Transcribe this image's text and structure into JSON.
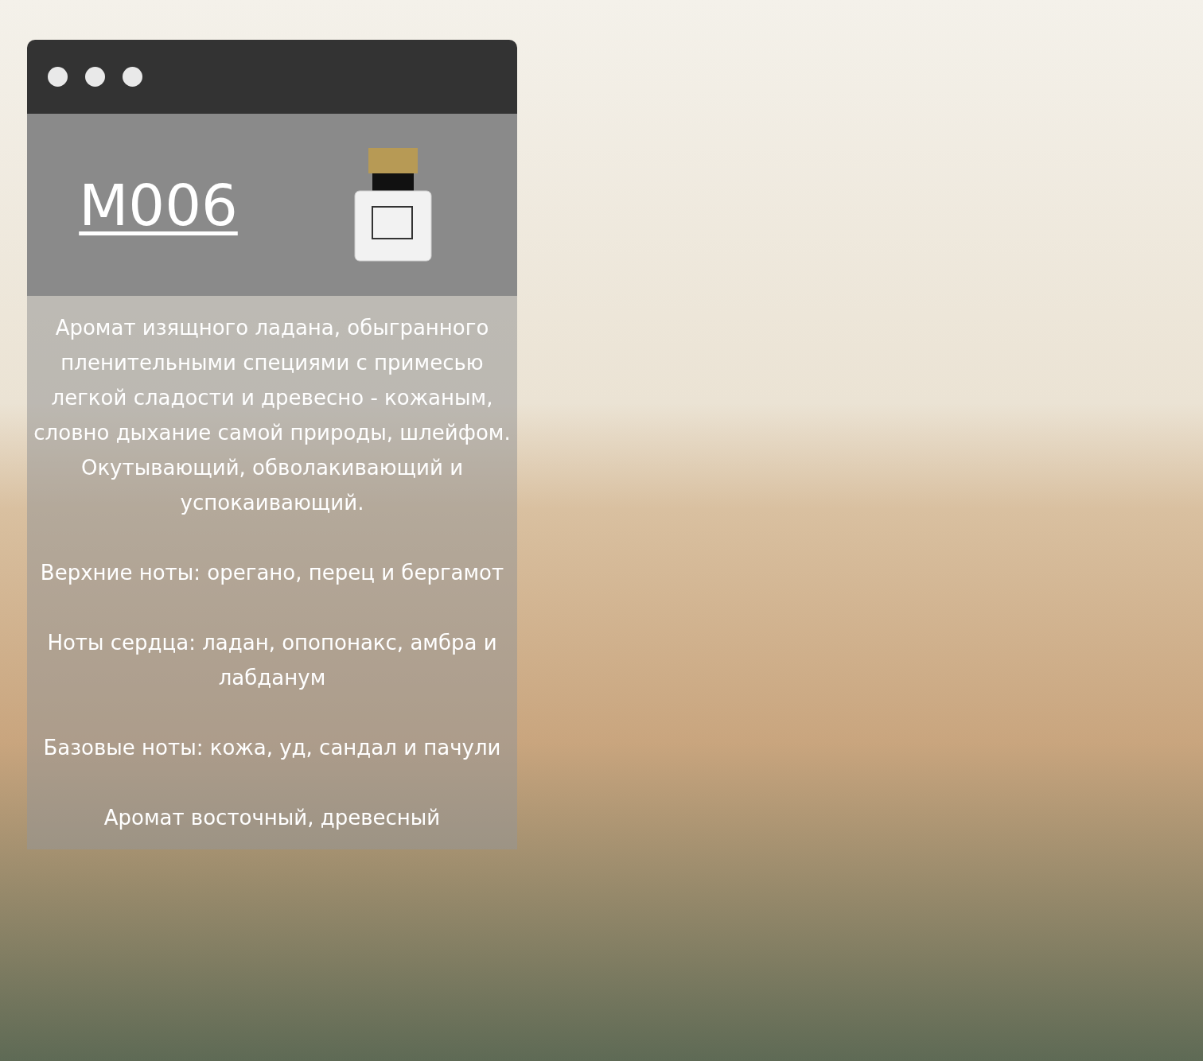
{
  "card": {
    "title": "M006",
    "paragraphs": [
      "Аромат изящного ладана, обыгранного пленительными специями с примесью легкой сладости и древесно - кожаным, словно дыхание самой природы, шлейфом. Окутывающий, обволакивающий и успокаивающий.",
      "Верхние ноты: орегано, перец и бергамот",
      "Ноты сердца: ладан, опопонакс, амбра и лабданум",
      "Базовые ноты: кожа, уд, сандал и пачули",
      "Аромат восточный, древесный"
    ]
  }
}
